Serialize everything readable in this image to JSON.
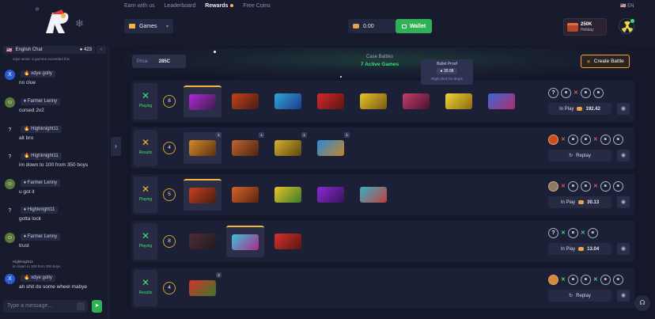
{
  "nav": {
    "earn": "Earn with us",
    "leaderboard": "Leaderboard",
    "rewards": "Rewards",
    "free_coins": "Free Coins",
    "lang": "EN"
  },
  "header": {
    "games": "Games",
    "balance": "0.00",
    "wallet": "Wallet",
    "promo_amount": "250K",
    "promo_label": "Holiday"
  },
  "chat": {
    "room": "English Chat",
    "online": "423",
    "messages": [
      {
        "avatar": "X",
        "name": "xdye golly",
        "text": "no clue"
      },
      {
        "avatar": "img",
        "name": "Farmer Lenny",
        "text": "cursed 2v2"
      },
      {
        "avatar": "?",
        "name": "Highknight11",
        "text": "alt bro"
      },
      {
        "avatar": "?",
        "name": "Highknight11",
        "text": "im down to 100 from 350 boys"
      },
      {
        "avatar": "img",
        "name": "Farmer Lenny",
        "text": "u got it"
      },
      {
        "avatar": "?",
        "name": "Highknight11",
        "text": "gotta lock"
      },
      {
        "avatar": "img",
        "name": "Farmer Lenny",
        "text": "trust"
      },
      {
        "avatar": "X",
        "name": "xdye golly",
        "text": "ah shit do some wheel mabye"
      }
    ],
    "top_reply": "xdye wrote: a gamma exceeded this",
    "reply_name": "Highknight11",
    "reply_text": "im down to 100 from 350 boys",
    "placeholder": "Type a message..."
  },
  "battles": {
    "price_label": "Price",
    "price_value": "285C",
    "title": "Case Battles",
    "active": "7 Active Games",
    "create": "Create Battle",
    "tooltip_name": "Bullet Proof",
    "tooltip_price": "30.08",
    "tooltip_hint": "Right click for drops",
    "rows": [
      {
        "status": "Playing",
        "count": "8",
        "action": "In Play",
        "amount": "192.42"
      },
      {
        "status": "Results",
        "count": "4",
        "action": "Replay",
        "amount": ""
      },
      {
        "status": "Playing",
        "count": "5",
        "action": "In Play",
        "amount": "30.13"
      },
      {
        "status": "Playing",
        "count": "8",
        "action": "In Play",
        "amount": "13.04"
      },
      {
        "status": "Results",
        "count": "4",
        "action": "Replay",
        "amount": ""
      }
    ]
  },
  "colors": {
    "accent": "#f3b73a",
    "green": "#2fb256",
    "bg": "#15182a"
  }
}
